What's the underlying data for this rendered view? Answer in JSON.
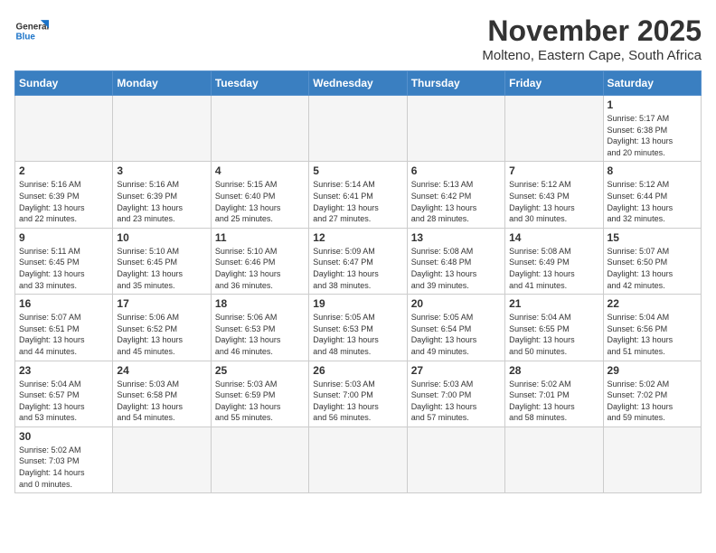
{
  "logo": {
    "line1": "General",
    "line2": "Blue"
  },
  "title": "November 2025",
  "location": "Molteno, Eastern Cape, South Africa",
  "weekdays": [
    "Sunday",
    "Monday",
    "Tuesday",
    "Wednesday",
    "Thursday",
    "Friday",
    "Saturday"
  ],
  "weeks": [
    [
      {
        "day": "",
        "info": ""
      },
      {
        "day": "",
        "info": ""
      },
      {
        "day": "",
        "info": ""
      },
      {
        "day": "",
        "info": ""
      },
      {
        "day": "",
        "info": ""
      },
      {
        "day": "",
        "info": ""
      },
      {
        "day": "1",
        "info": "Sunrise: 5:17 AM\nSunset: 6:38 PM\nDaylight: 13 hours\nand 20 minutes."
      }
    ],
    [
      {
        "day": "2",
        "info": "Sunrise: 5:16 AM\nSunset: 6:39 PM\nDaylight: 13 hours\nand 22 minutes."
      },
      {
        "day": "3",
        "info": "Sunrise: 5:16 AM\nSunset: 6:39 PM\nDaylight: 13 hours\nand 23 minutes."
      },
      {
        "day": "4",
        "info": "Sunrise: 5:15 AM\nSunset: 6:40 PM\nDaylight: 13 hours\nand 25 minutes."
      },
      {
        "day": "5",
        "info": "Sunrise: 5:14 AM\nSunset: 6:41 PM\nDaylight: 13 hours\nand 27 minutes."
      },
      {
        "day": "6",
        "info": "Sunrise: 5:13 AM\nSunset: 6:42 PM\nDaylight: 13 hours\nand 28 minutes."
      },
      {
        "day": "7",
        "info": "Sunrise: 5:12 AM\nSunset: 6:43 PM\nDaylight: 13 hours\nand 30 minutes."
      },
      {
        "day": "8",
        "info": "Sunrise: 5:12 AM\nSunset: 6:44 PM\nDaylight: 13 hours\nand 32 minutes."
      }
    ],
    [
      {
        "day": "9",
        "info": "Sunrise: 5:11 AM\nSunset: 6:45 PM\nDaylight: 13 hours\nand 33 minutes."
      },
      {
        "day": "10",
        "info": "Sunrise: 5:10 AM\nSunset: 6:45 PM\nDaylight: 13 hours\nand 35 minutes."
      },
      {
        "day": "11",
        "info": "Sunrise: 5:10 AM\nSunset: 6:46 PM\nDaylight: 13 hours\nand 36 minutes."
      },
      {
        "day": "12",
        "info": "Sunrise: 5:09 AM\nSunset: 6:47 PM\nDaylight: 13 hours\nand 38 minutes."
      },
      {
        "day": "13",
        "info": "Sunrise: 5:08 AM\nSunset: 6:48 PM\nDaylight: 13 hours\nand 39 minutes."
      },
      {
        "day": "14",
        "info": "Sunrise: 5:08 AM\nSunset: 6:49 PM\nDaylight: 13 hours\nand 41 minutes."
      },
      {
        "day": "15",
        "info": "Sunrise: 5:07 AM\nSunset: 6:50 PM\nDaylight: 13 hours\nand 42 minutes."
      }
    ],
    [
      {
        "day": "16",
        "info": "Sunrise: 5:07 AM\nSunset: 6:51 PM\nDaylight: 13 hours\nand 44 minutes."
      },
      {
        "day": "17",
        "info": "Sunrise: 5:06 AM\nSunset: 6:52 PM\nDaylight: 13 hours\nand 45 minutes."
      },
      {
        "day": "18",
        "info": "Sunrise: 5:06 AM\nSunset: 6:53 PM\nDaylight: 13 hours\nand 46 minutes."
      },
      {
        "day": "19",
        "info": "Sunrise: 5:05 AM\nSunset: 6:53 PM\nDaylight: 13 hours\nand 48 minutes."
      },
      {
        "day": "20",
        "info": "Sunrise: 5:05 AM\nSunset: 6:54 PM\nDaylight: 13 hours\nand 49 minutes."
      },
      {
        "day": "21",
        "info": "Sunrise: 5:04 AM\nSunset: 6:55 PM\nDaylight: 13 hours\nand 50 minutes."
      },
      {
        "day": "22",
        "info": "Sunrise: 5:04 AM\nSunset: 6:56 PM\nDaylight: 13 hours\nand 51 minutes."
      }
    ],
    [
      {
        "day": "23",
        "info": "Sunrise: 5:04 AM\nSunset: 6:57 PM\nDaylight: 13 hours\nand 53 minutes."
      },
      {
        "day": "24",
        "info": "Sunrise: 5:03 AM\nSunset: 6:58 PM\nDaylight: 13 hours\nand 54 minutes."
      },
      {
        "day": "25",
        "info": "Sunrise: 5:03 AM\nSunset: 6:59 PM\nDaylight: 13 hours\nand 55 minutes."
      },
      {
        "day": "26",
        "info": "Sunrise: 5:03 AM\nSunset: 7:00 PM\nDaylight: 13 hours\nand 56 minutes."
      },
      {
        "day": "27",
        "info": "Sunrise: 5:03 AM\nSunset: 7:00 PM\nDaylight: 13 hours\nand 57 minutes."
      },
      {
        "day": "28",
        "info": "Sunrise: 5:02 AM\nSunset: 7:01 PM\nDaylight: 13 hours\nand 58 minutes."
      },
      {
        "day": "29",
        "info": "Sunrise: 5:02 AM\nSunset: 7:02 PM\nDaylight: 13 hours\nand 59 minutes."
      }
    ],
    [
      {
        "day": "30",
        "info": "Sunrise: 5:02 AM\nSunset: 7:03 PM\nDaylight: 14 hours\nand 0 minutes."
      },
      {
        "day": "",
        "info": ""
      },
      {
        "day": "",
        "info": ""
      },
      {
        "day": "",
        "info": ""
      },
      {
        "day": "",
        "info": ""
      },
      {
        "day": "",
        "info": ""
      },
      {
        "day": "",
        "info": ""
      }
    ]
  ]
}
